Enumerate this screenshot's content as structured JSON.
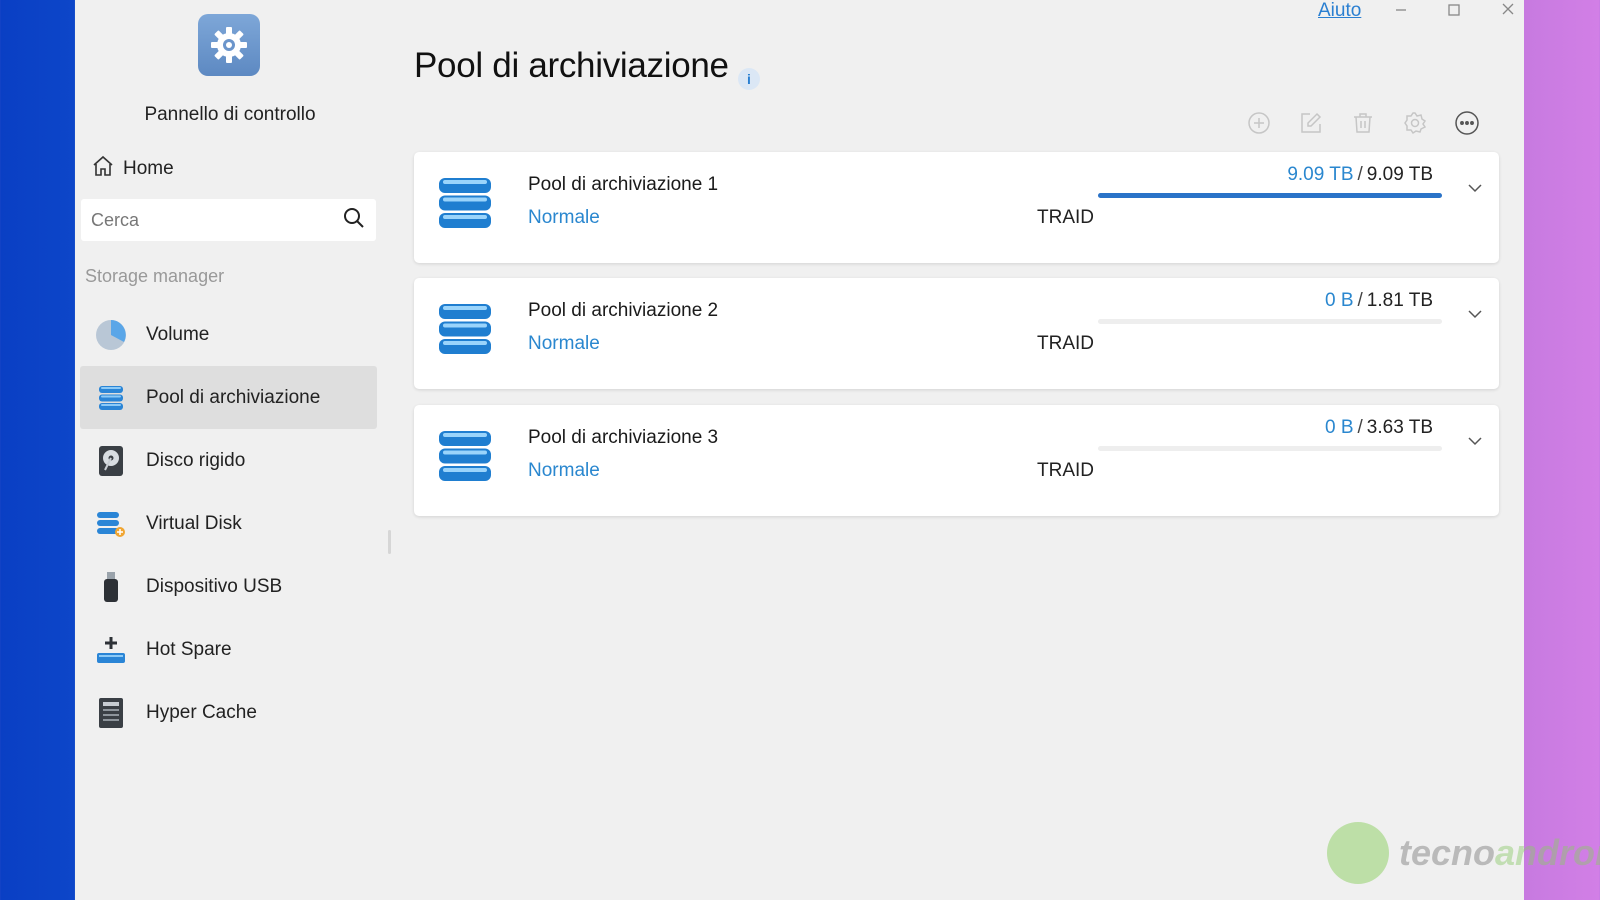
{
  "app": {
    "title": "Pannello di controllo",
    "home_label": "Home",
    "help_label": "Aiuto",
    "logo_icon": "gear-icon"
  },
  "search": {
    "placeholder": "Cerca"
  },
  "sidebar": {
    "section_label": "Storage manager",
    "items": [
      {
        "label": "Volume",
        "icon": "pie-chart-icon",
        "active": false
      },
      {
        "label": "Pool di archiviazione",
        "icon": "database-icon",
        "active": true
      },
      {
        "label": "Disco rigido",
        "icon": "hard-disk-icon",
        "active": false
      },
      {
        "label": "Virtual Disk",
        "icon": "virtual-disk-icon",
        "active": false
      },
      {
        "label": "Dispositivo USB",
        "icon": "usb-drive-icon",
        "active": false
      },
      {
        "label": "Hot Spare",
        "icon": "hot-spare-icon",
        "active": false
      },
      {
        "label": "Hyper Cache",
        "icon": "ssd-cache-icon",
        "active": false
      }
    ]
  },
  "main": {
    "title": "Pool di archiviazione",
    "toolbar": [
      "add-icon",
      "edit-icon",
      "delete-icon",
      "settings-icon",
      "more-icon"
    ],
    "pools": [
      {
        "name": "Pool di archiviazione 1",
        "status": "Normale",
        "type": "TRAID",
        "used": "9.09 TB",
        "separator": "/",
        "total": "9.09 TB",
        "usage_fraction": 1.0
      },
      {
        "name": "Pool di archiviazione 2",
        "status": "Normale",
        "type": "TRAID",
        "used": "0 B",
        "separator": "/",
        "total": "1.81 TB",
        "usage_fraction": 0.0
      },
      {
        "name": "Pool di archiviazione 3",
        "status": "Normale",
        "type": "TRAID",
        "used": "0 B",
        "separator": "/",
        "total": "3.63 TB",
        "usage_fraction": 0.0
      }
    ]
  },
  "colors": {
    "accent": "#2a87cf",
    "bar": "#2a73c8",
    "active_bg": "#dedede"
  },
  "watermark": {
    "text_a": "tecno",
    "text_b": "android"
  }
}
